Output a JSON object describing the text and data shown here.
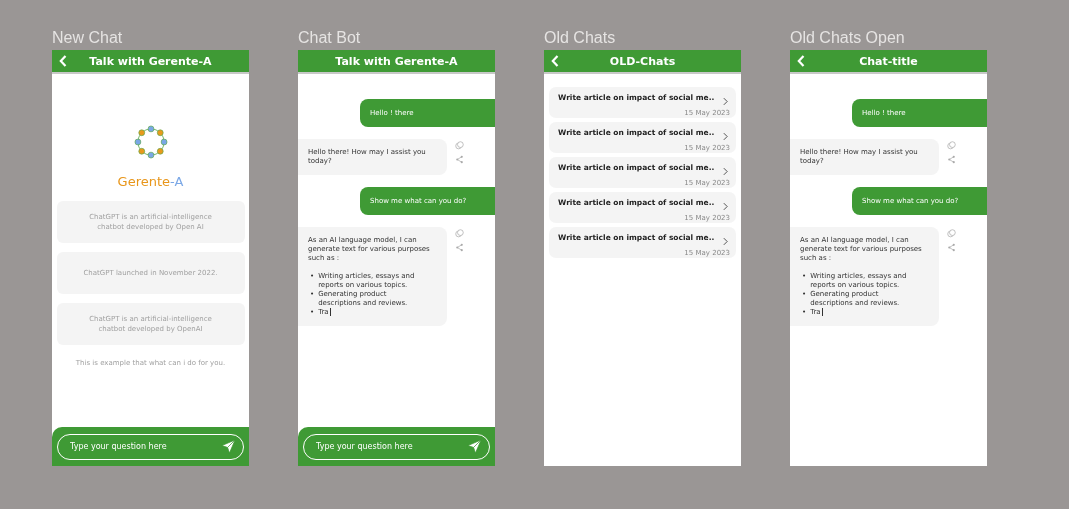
{
  "frames": [
    {
      "kind": "intro",
      "label": "New Chat",
      "header": {
        "title": "Talk with Gerente-A",
        "back": true
      },
      "brand": [
        "Gerente",
        "-A"
      ],
      "examples": [
        "ChatGPT is an artificial-intelligence chatbot developed by Open AI",
        "ChatGPT launched in November 2022.",
        "ChatGPT is an artificial-intelligence chatbot developed by OpenAI"
      ],
      "note": "This is example that what can i do for you.",
      "input": {
        "placeholder": "Type your question here"
      }
    },
    {
      "kind": "chat",
      "label": "Chat Bot",
      "header": {
        "title": "Talk with Gerente-A",
        "back": false
      },
      "messages": [
        {
          "kind": "user",
          "text": "Hello ! there"
        },
        {
          "kind": "bot",
          "text": "Hello there! How may I assist you today?"
        },
        {
          "kind": "user",
          "text": "Show me what can you do?"
        },
        {
          "kind": "bot",
          "text": "As an AI language model, I can generate text for various purposes such as :",
          "bullet": "•",
          "bullets": [
            "Writing articles, essays and reports on various topics.",
            "Generating product descriptions and reviews.",
            "Tra"
          ],
          "typing": true
        }
      ],
      "input": {
        "placeholder": "Type your question here"
      }
    },
    {
      "kind": "history",
      "label": "Old Chats",
      "header": {
        "title": "OLD-Chats",
        "back": true
      },
      "items": [
        {
          "title": "Write article on impact of social me..",
          "date": "15 May 2023"
        },
        {
          "title": "Write article on impact of social me..",
          "date": "15 May 2023"
        },
        {
          "title": "Write article on impact of social me..",
          "date": "15 May 2023"
        },
        {
          "title": "Write article on impact of social me..",
          "date": "15 May 2023"
        },
        {
          "title": "Write article on impact of social me..",
          "date": "15 May 2023"
        }
      ]
    },
    {
      "kind": "chat",
      "label": "Old Chats Open",
      "header": {
        "title": "Chat-title",
        "back": true
      },
      "messages": [
        {
          "kind": "user",
          "text": "Hello ! there"
        },
        {
          "kind": "bot",
          "text": "Hello there! How may I assist you today?"
        },
        {
          "kind": "user",
          "text": "Show me what can you do?"
        },
        {
          "kind": "bot",
          "text": "As an AI language model, I can generate text for various purposes such as :",
          "bullet": "•",
          "bullets": [
            "Writing articles, essays and reports on various topics.",
            "Generating product descriptions and reviews.",
            "Tra"
          ],
          "typing": true
        }
      ]
    }
  ]
}
